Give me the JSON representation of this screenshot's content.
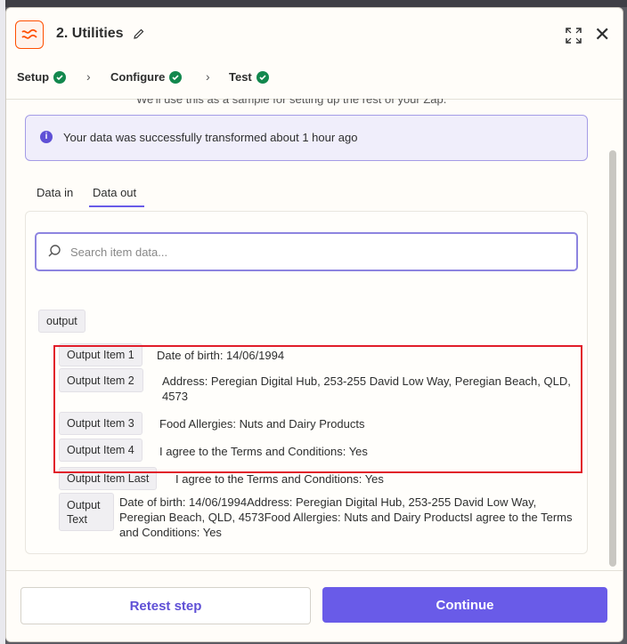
{
  "header": {
    "title": "2. Utilities"
  },
  "steps": [
    {
      "label": "Setup"
    },
    {
      "label": "Configure"
    },
    {
      "label": "Test"
    }
  ],
  "content": {
    "partial_text": "We'll use this as a sample for setting up the rest of your Zap.",
    "info_message": "Your data was successfully transformed about 1 hour ago",
    "tabs": [
      {
        "label": "Data in"
      },
      {
        "label": "Data out"
      }
    ],
    "search": {
      "placeholder": "Search item data..."
    },
    "group_label": "output",
    "items": [
      {
        "key": "Output Item 1",
        "value": "Date of birth: 14/06/1994"
      },
      {
        "key": "Output Item 2",
        "value": "Address: Peregian Digital Hub, 253-255 David Low Way, Peregian Beach, QLD, 4573"
      },
      {
        "key": "Output Item 3",
        "value": "Food Allergies: Nuts and Dairy Products"
      },
      {
        "key": "Output Item 4",
        "value": "I agree to the Terms and Conditions: Yes"
      },
      {
        "key": "Output Item Last",
        "value": "I agree to the Terms and Conditions: Yes"
      },
      {
        "key": "Output Text",
        "value": "Date of birth: 14/06/1994Address: Peregian Digital Hub, 253-255 David Low Way, Peregian Beach, QLD, 4573Food Allergies: Nuts and Dairy ProductsI agree to the Terms and Conditions: Yes"
      }
    ]
  },
  "footer": {
    "retest_label": "Retest step",
    "continue_label": "Continue"
  },
  "colors": {
    "accent": "#695be8",
    "success": "#13884e",
    "brand": "#ff4f00",
    "highlight": "#e11d2a"
  }
}
